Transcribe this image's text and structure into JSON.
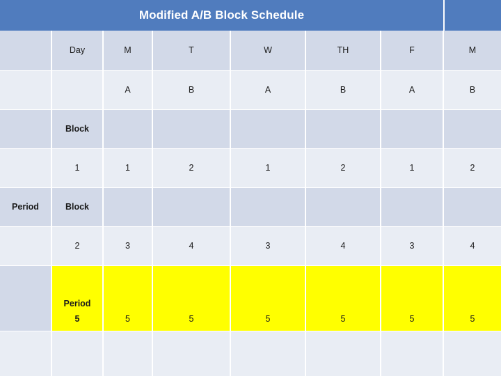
{
  "title": "Modified A/B Block Schedule",
  "colors": {
    "title_band": "#507cbe",
    "title_text": "#ffffff",
    "row_dark": "#d2d9e8",
    "row_light": "#e9edf4",
    "highlight": "#ffff00",
    "text": "#1b1b1b"
  },
  "labels": {
    "day": "Day",
    "period": "Period",
    "block_1": "Block",
    "block_2": "Block",
    "period_5_line1": "Period",
    "period_5_line2": "5"
  },
  "table": {
    "columns": [
      "",
      "Day",
      "M",
      "T",
      "W",
      "TH",
      "F",
      "M"
    ],
    "rows": [
      {
        "name": "day-header",
        "style": "dark",
        "cells": [
          "",
          "Day",
          "M",
          "T",
          "W",
          "TH",
          "F",
          "M"
        ]
      },
      {
        "name": "ab-row",
        "style": "light",
        "cells": [
          "",
          "",
          "A",
          "B",
          "A",
          "B",
          "A",
          "B"
        ]
      },
      {
        "name": "block-1-label",
        "style": "dark",
        "cells": [
          "",
          "Block",
          "",
          "",
          "",
          "",
          "",
          ""
        ]
      },
      {
        "name": "block-1-values",
        "style": "light",
        "cells": [
          "",
          "1",
          "1",
          "2",
          "1",
          "2",
          "1",
          "2"
        ]
      },
      {
        "name": "block-2-label",
        "style": "dark",
        "cells": [
          "Period",
          "Block",
          "",
          "",
          "",
          "",
          "",
          ""
        ]
      },
      {
        "name": "block-2-values",
        "style": "light",
        "cells": [
          "",
          "2",
          "3",
          "4",
          "3",
          "4",
          "3",
          "4"
        ]
      },
      {
        "name": "period-5-row",
        "style": "highlight",
        "cells": [
          "",
          "Period 5",
          "5",
          "5",
          "5",
          "5",
          "5",
          "5"
        ]
      },
      {
        "name": "spacer-row",
        "style": "light",
        "cells": [
          "",
          "",
          "",
          "",
          "",
          "",
          "",
          ""
        ]
      }
    ]
  }
}
